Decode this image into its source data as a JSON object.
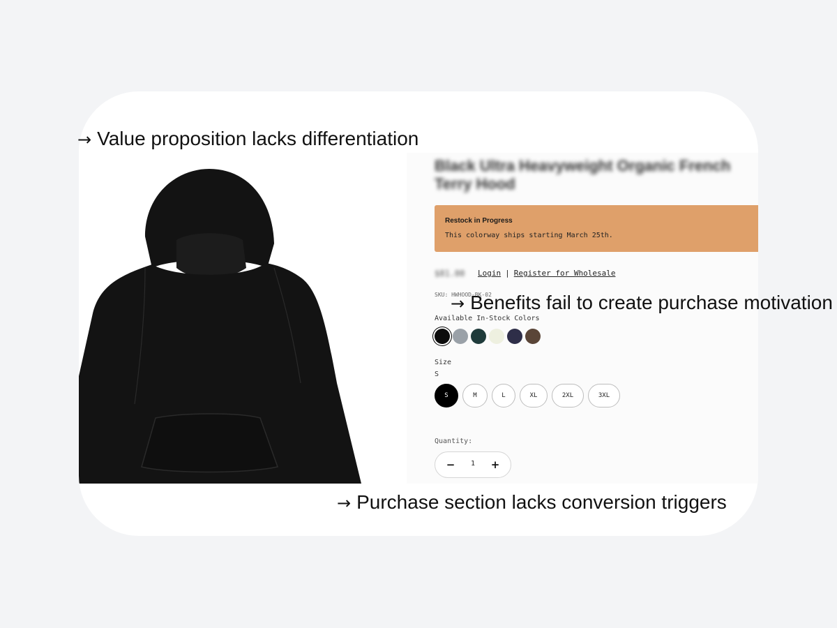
{
  "annotations": [
    {
      "arrow": "→",
      "text": "Value proposition lacks differentiation"
    },
    {
      "arrow": "→",
      "text": "Benefits fail to create purchase motivation"
    },
    {
      "arrow": "→",
      "text": "Purchase section lacks conversion triggers"
    }
  ],
  "product": {
    "title": "Black Ultra Heavyweight Organic French Terry Hood",
    "restock": {
      "title": "Restock in Progress",
      "text": "This colorway ships starting March 25th."
    },
    "price": "$81.00",
    "login_link": "Login",
    "separator": "|",
    "wholesale_link": "Register for Wholesale",
    "sku": "SKU: HWHOOD-BK-02",
    "colors_label": "Available In-Stock Colors",
    "colors": [
      {
        "name": "black",
        "hex": "#0d0d0d",
        "selected": true
      },
      {
        "name": "grey",
        "hex": "#9aa1a8",
        "selected": false
      },
      {
        "name": "dark-teal",
        "hex": "#1f3b3b",
        "selected": false
      },
      {
        "name": "cream",
        "hex": "#eef0e0",
        "selected": false
      },
      {
        "name": "navy",
        "hex": "#2e2e48",
        "selected": false
      },
      {
        "name": "brown",
        "hex": "#5a4538",
        "selected": false
      }
    ],
    "size_label": "Size",
    "size_selected": "S",
    "sizes": [
      "S",
      "M",
      "L",
      "XL",
      "2XL",
      "3XL"
    ],
    "quantity_label": "Quantity:",
    "quantity": "1",
    "minus_symbol": "−",
    "plus_symbol": "+"
  },
  "colors": {
    "page_background": "#f3f4f6",
    "card_background": "#ffffff",
    "banner_background": "#dfa06a",
    "hoodie": "#131313"
  }
}
